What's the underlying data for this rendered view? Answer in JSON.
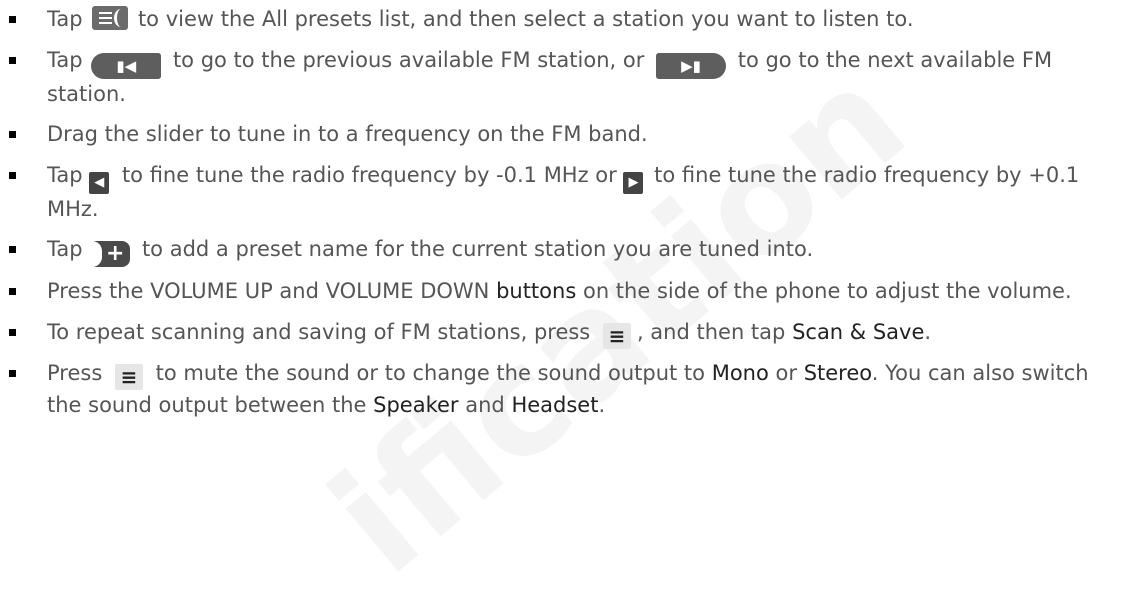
{
  "watermark": "ification",
  "colors": {
    "text": "#555555",
    "emphasis": "#222222",
    "icon_dark": "#5e5e5e",
    "bullet": "#000000"
  },
  "icons": {
    "presets": "all-presets-menu-icon",
    "prev": "previous-station-icon",
    "next": "next-station-icon",
    "fine_down": "fine-tune-down-icon",
    "fine_up": "fine-tune-up-icon",
    "add": "add-preset-icon",
    "menu": "menu-icon"
  },
  "items": [
    {
      "t1": "Tap",
      "t2": "to view the All presets list, and then select a station you want to listen to."
    },
    {
      "t1": "Tap",
      "t2": "to go to the previous available FM station, or",
      "t3": "to go to the next available FM station."
    },
    {
      "t1": "Drag the slider to tune in to a frequency on the FM band."
    },
    {
      "t1": "Tap",
      "t2": "to fine tune the radio frequency by -0.1 MHz or",
      "t3": "to fine tune the radio frequency by +0.1 MHz."
    },
    {
      "t1": "Tap",
      "t2": "to add a preset name for the current station you are tuned into."
    },
    {
      "t1": "Press the VOLUME UP and VOLUME DOWN",
      "t2": "buttons",
      "t3": "on the side of the phone to adjust the volume."
    },
    {
      "t1": "To repeat scanning and saving of FM stations, press",
      "t2": ", and then tap",
      "t3": "Scan & Save",
      "t4": "."
    },
    {
      "t1": "Press",
      "t2": "to mute the sound or to change the sound output to",
      "t3": "Mono",
      "t4": "or",
      "t5": "Stereo",
      "t6": ". You can also switch the sound output between the",
      "t7": "Speaker",
      "t8": "and",
      "t9": "Headset",
      "t10": "."
    }
  ]
}
